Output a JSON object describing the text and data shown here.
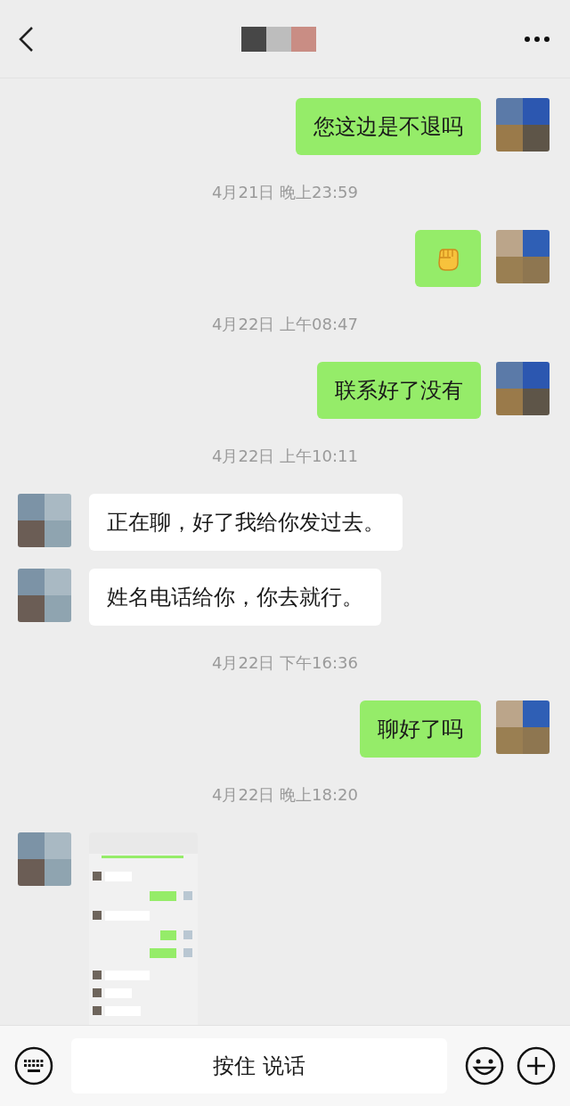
{
  "messages": [
    {
      "kind": "text-out",
      "text": "您这边是不退吗"
    },
    {
      "kind": "time",
      "text": "4月21日 晚上23:59"
    },
    {
      "kind": "emoji-out"
    },
    {
      "kind": "time",
      "text": "4月22日 上午08:47"
    },
    {
      "kind": "text-out",
      "text": "联系好了没有"
    },
    {
      "kind": "time",
      "text": "4月22日 上午10:11"
    },
    {
      "kind": "text-in",
      "text": "正在聊，好了我给你发过去。"
    },
    {
      "kind": "text-in",
      "text": "姓名电话给你，你去就行。"
    },
    {
      "kind": "time",
      "text": "4月22日 下午16:36"
    },
    {
      "kind": "text-out",
      "text": "聊好了吗"
    },
    {
      "kind": "time",
      "text": "4月22日 晚上18:20"
    },
    {
      "kind": "image-in"
    }
  ],
  "input": {
    "voice_button": "按住 说话"
  }
}
